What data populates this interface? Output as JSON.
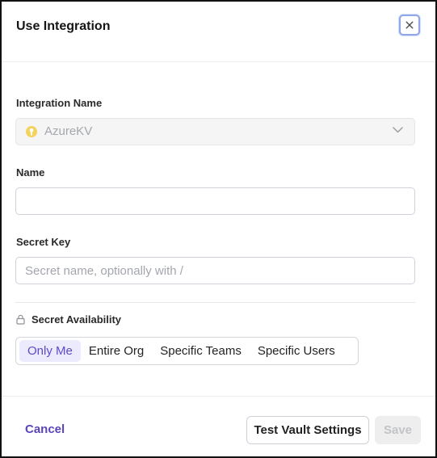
{
  "dialog": {
    "title": "Use Integration"
  },
  "integration_name": {
    "label": "Integration Name",
    "value": "AzureKV",
    "icon": "key-vault-icon"
  },
  "name": {
    "label": "Name",
    "value": "",
    "placeholder": ""
  },
  "secret_key": {
    "label": "Secret Key",
    "value": "",
    "placeholder": "Secret name, optionally with /"
  },
  "availability": {
    "label": "Secret Availability",
    "icon": "lock-icon",
    "options": [
      "Only Me",
      "Entire Org",
      "Specific Teams",
      "Specific Users"
    ],
    "selected": "Only Me"
  },
  "footer": {
    "cancel_label": "Cancel",
    "test_label": "Test Vault Settings",
    "save_label": "Save"
  },
  "colors": {
    "accent": "#5a45b8",
    "selected_bg": "#eceafd",
    "focus_ring": "#8fa7e6"
  }
}
